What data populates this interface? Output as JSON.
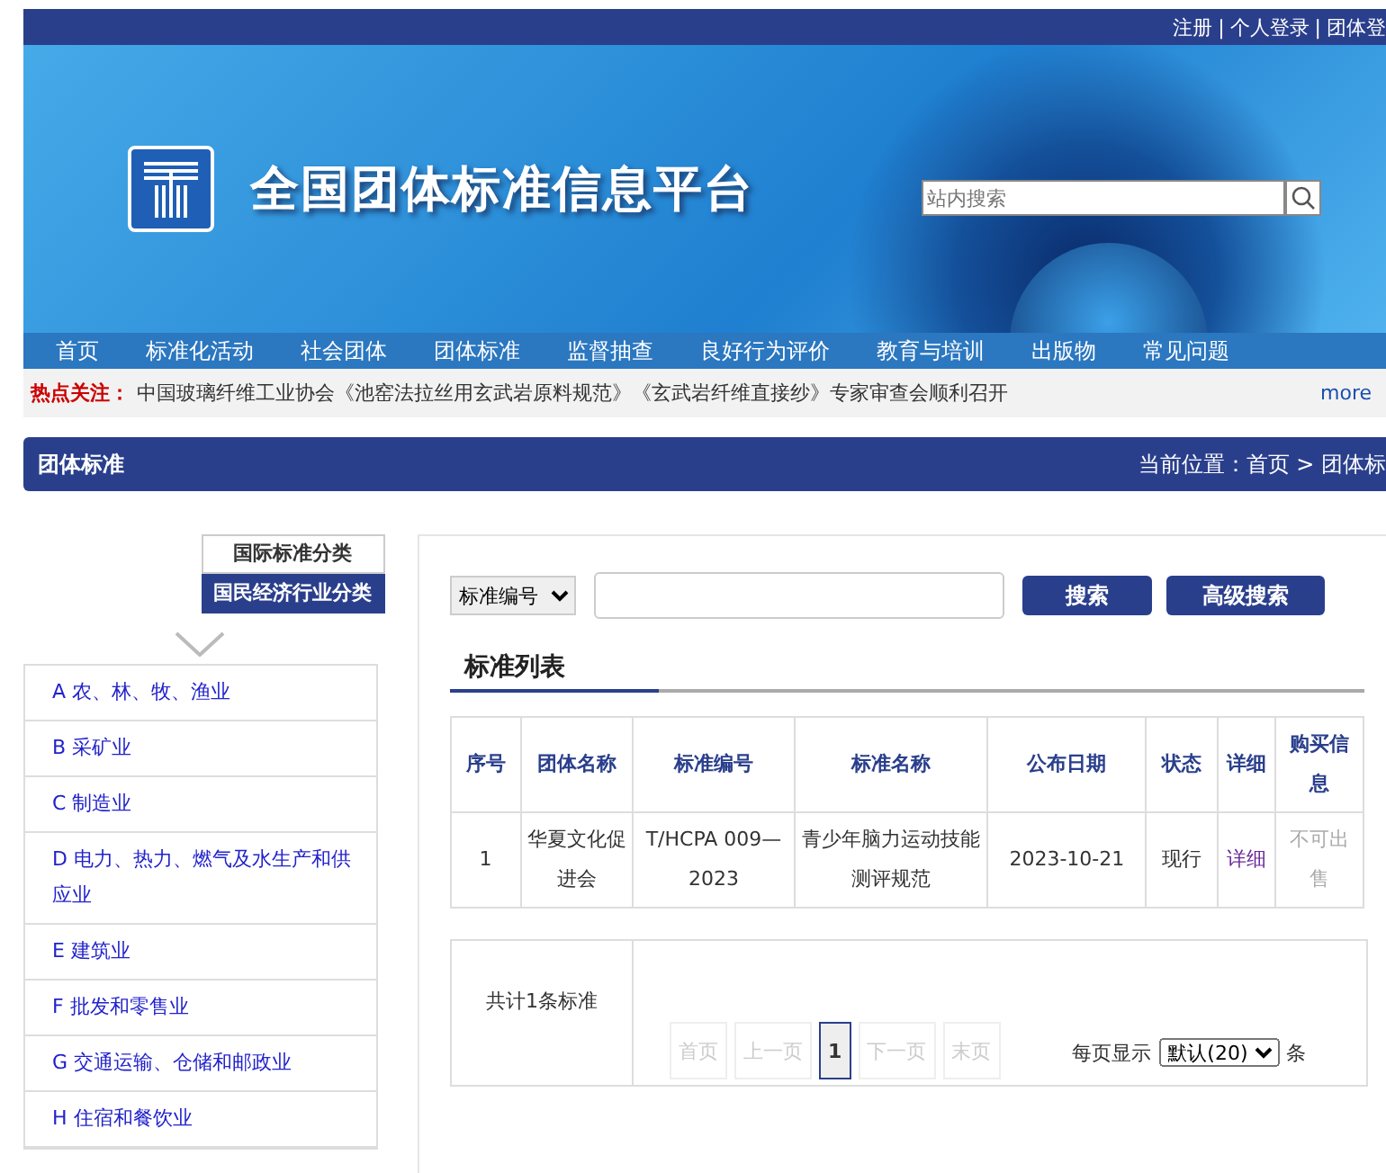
{
  "top_links": [
    "注册",
    "个人登录",
    "团体登"
  ],
  "top_separator": "|",
  "site_title": "全国团体标准信息平台",
  "site_search": {
    "placeholder": "站内搜索"
  },
  "nav": [
    "首页",
    "标准化活动",
    "社会团体",
    "团体标准",
    "监督抽查",
    "良好行为评价",
    "教育与培训",
    "出版物",
    "常见问题"
  ],
  "hot": {
    "label": "热点关注：",
    "text": "中国玻璃纤维工业协会《池窑法拉丝用玄武岩原料规范》《玄武岩纤维直接纱》专家审查会顺利召开",
    "more": "more"
  },
  "section": {
    "title": "团体标准",
    "breadcrumb": "当前位置：首页 > 团体标"
  },
  "class_tabs": [
    {
      "label": "国际标准分类",
      "selected": false
    },
    {
      "label": "国民经济行业分类",
      "selected": true
    }
  ],
  "categories": [
    "A 农、林、牧、渔业",
    "B 采矿业",
    "C 制造业",
    "D 电力、热力、燃气及水生产和供应业",
    "E 建筑业",
    "F 批发和零售业",
    "G 交通运输、仓储和邮政业",
    "H 住宿和餐饮业"
  ],
  "search": {
    "field_select": "标准编号",
    "search_button": "搜索",
    "advanced_button": "高级搜索"
  },
  "list_title": "标准列表",
  "table": {
    "columns": [
      "序号",
      "团体名称",
      "标准编号",
      "标准名称",
      "公布日期",
      "状态",
      "详细",
      "购买信息"
    ],
    "rows": [
      {
        "cells": [
          "1",
          "华夏文化促进会",
          "T/HCPA 009—2023",
          "青少年脑力运动技能测评规范",
          "2023-10-21",
          "现行",
          "详细",
          "不可出售"
        ]
      }
    ]
  },
  "pager": {
    "total": "共计1条标准",
    "buttons": [
      {
        "label": "首页",
        "disabled": true,
        "selected": false
      },
      {
        "label": "上一页",
        "disabled": true,
        "selected": false
      },
      {
        "label": "1",
        "disabled": false,
        "selected": true
      },
      {
        "label": "下一页",
        "disabled": true,
        "selected": false
      },
      {
        "label": "末页",
        "disabled": true,
        "selected": false
      }
    ],
    "per_page_label": "每页显示",
    "per_page": "默认(20)",
    "unit": "条"
  }
}
